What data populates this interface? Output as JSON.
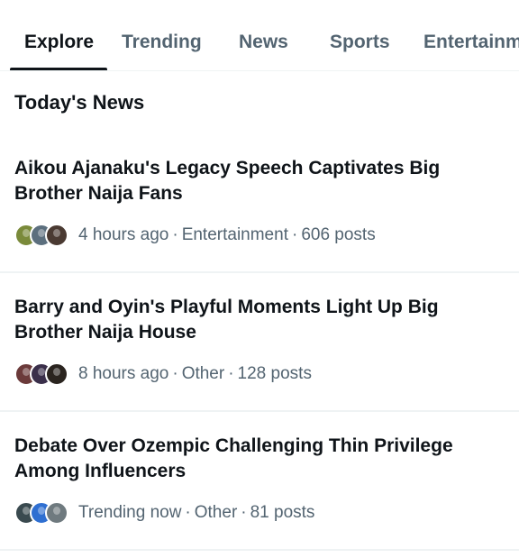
{
  "tabs": [
    {
      "label": "Explore",
      "active": true
    },
    {
      "label": "Trending",
      "active": false
    },
    {
      "label": "News",
      "active": false
    },
    {
      "label": "Sports",
      "active": false
    },
    {
      "label": "Entertainment",
      "active": false
    }
  ],
  "section_title": "Today's News",
  "stories": [
    {
      "title": "Aikou Ajanaku's Legacy Speech Captivates Big Brother Naija Fans",
      "time": "4 hours ago",
      "category": "Entertainment",
      "posts": "606 posts",
      "avatar_colors": [
        "#7a8a3a",
        "#5c6f7e",
        "#4a3a32"
      ]
    },
    {
      "title": "Barry and Oyin's Playful Moments Light Up Big Brother Naija House",
      "time": "8 hours ago",
      "category": "Other",
      "posts": "128 posts",
      "avatar_colors": [
        "#6b3a3a",
        "#3a2f4a",
        "#2a241f"
      ]
    },
    {
      "title": "Debate Over Ozempic Challenging Thin Privilege Among Influencers",
      "time": "Trending now",
      "category": "Other",
      "posts": "81 posts",
      "avatar_colors": [
        "#3a4a4f",
        "#2f6fd1",
        "#6f7a7f"
      ]
    }
  ],
  "separator": "·",
  "accent_color": "#0f1419",
  "muted_color": "#536471"
}
